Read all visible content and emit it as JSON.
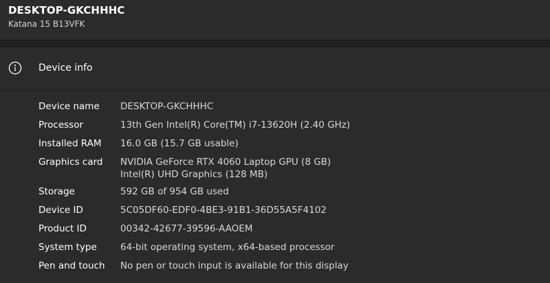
{
  "header": {
    "device_title": "DESKTOP-GKCHHHC",
    "device_model": "Katana 15 B13VFK"
  },
  "device_info": {
    "title": "Device info",
    "icon": "info-icon",
    "rows": [
      {
        "label": "Device name",
        "value": "DESKTOP-GKCHHHC"
      },
      {
        "label": "Processor",
        "value": "13th Gen Intel(R) Core(TM) i7-13620H (2.40 GHz)"
      },
      {
        "label": "Installed RAM",
        "value": "16.0 GB (15.7 GB usable)"
      },
      {
        "label": "Graphics card",
        "value_lines": [
          "NVIDIA GeForce RTX 4060 Laptop GPU (8 GB)",
          "Intel(R) UHD Graphics (128 MB)"
        ]
      },
      {
        "label": "Storage",
        "value": "592 GB of 954 GB used"
      },
      {
        "label": "Device ID",
        "value": "5C05DF60-EDF0-4BE3-91B1-36D55A5F4102"
      },
      {
        "label": "Product ID",
        "value": "00342-42677-39596-AAOEM"
      },
      {
        "label": "System type",
        "value": "64-bit operating system, x64-based processor"
      },
      {
        "label": "Pen and touch",
        "value": "No pen or touch input is available for this display"
      }
    ]
  },
  "colors": {
    "background": "#202020",
    "card": "#2b2b2b",
    "text_primary": "#ffffff",
    "text_secondary": "#d8d8d8"
  }
}
